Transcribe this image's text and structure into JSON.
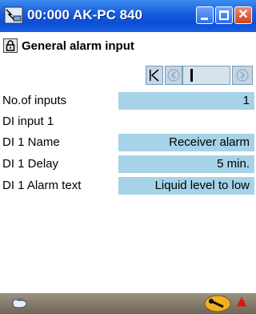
{
  "window": {
    "title": "00:000 AK-PC 840"
  },
  "page": {
    "title": "General alarm input"
  },
  "rows": [
    {
      "label": "No.of inputs",
      "value": "1"
    },
    {
      "label": "DI input 1",
      "value": null
    },
    {
      "label": "DI 1 Name",
      "value": "Receiver alarm"
    },
    {
      "label": "DI 1 Delay",
      "value": "5 min."
    },
    {
      "label": "DI 1 Alarm text",
      "value": "Liquid level to low"
    }
  ],
  "colors": {
    "titlebar": "#1a5fe0",
    "value_field": "#a6d3e8",
    "bottombar": "#7d7466",
    "alarm": "#e81010"
  },
  "icons": {
    "title": "pc-connection-icon",
    "lock": "lock-icon",
    "first": "first-page-icon",
    "prev": "previous-page-icon",
    "next": "next-page-icon",
    "hand": "hand-icon",
    "key": "key-icon",
    "bell": "alarm-bell-icon"
  }
}
